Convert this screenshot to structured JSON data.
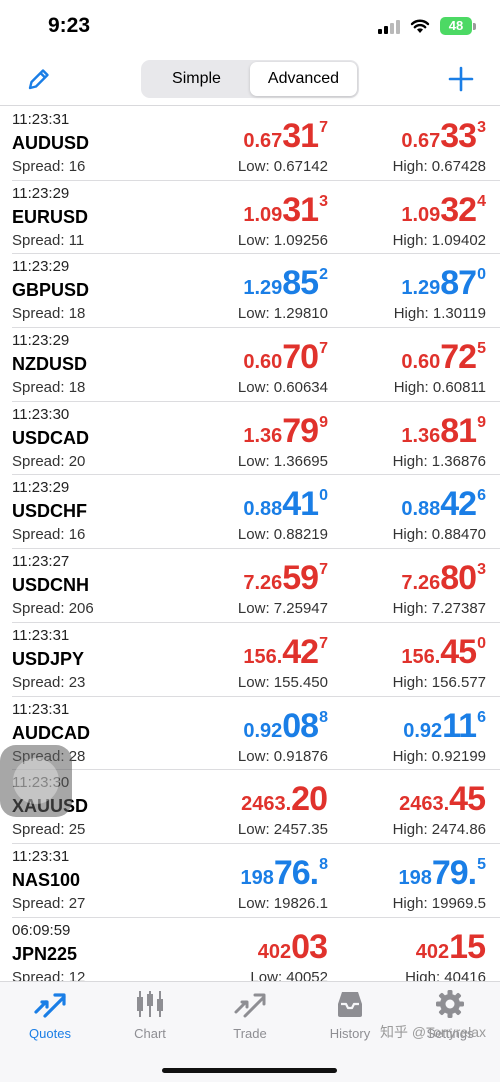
{
  "status": {
    "time": "9:23",
    "battery": "48"
  },
  "toolbar": {
    "segments": [
      {
        "label": "Simple",
        "active": false
      },
      {
        "label": "Advanced",
        "active": true
      }
    ]
  },
  "quotes": [
    {
      "time": "11:23:31",
      "symbol": "AUDUSD",
      "spread": "Spread: 16",
      "low": "Low: 0.67142",
      "high": "High: 0.67428",
      "bid": {
        "pre": "0.67",
        "big": "31",
        "sup": "7",
        "dir": "down"
      },
      "ask": {
        "pre": "0.67",
        "big": "33",
        "sup": "3",
        "dir": "down"
      }
    },
    {
      "time": "11:23:29",
      "symbol": "EURUSD",
      "spread": "Spread: 11",
      "low": "Low: 1.09256",
      "high": "High: 1.09402",
      "bid": {
        "pre": "1.09",
        "big": "31",
        "sup": "3",
        "dir": "down"
      },
      "ask": {
        "pre": "1.09",
        "big": "32",
        "sup": "4",
        "dir": "down"
      }
    },
    {
      "time": "11:23:29",
      "symbol": "GBPUSD",
      "spread": "Spread: 18",
      "low": "Low: 1.29810",
      "high": "High: 1.30119",
      "bid": {
        "pre": "1.29",
        "big": "85",
        "sup": "2",
        "dir": "up"
      },
      "ask": {
        "pre": "1.29",
        "big": "87",
        "sup": "0",
        "dir": "up"
      }
    },
    {
      "time": "11:23:29",
      "symbol": "NZDUSD",
      "spread": "Spread: 18",
      "low": "Low: 0.60634",
      "high": "High: 0.60811",
      "bid": {
        "pre": "0.60",
        "big": "70",
        "sup": "7",
        "dir": "down"
      },
      "ask": {
        "pre": "0.60",
        "big": "72",
        "sup": "5",
        "dir": "down"
      }
    },
    {
      "time": "11:23:30",
      "symbol": "USDCAD",
      "spread": "Spread: 20",
      "low": "Low: 1.36695",
      "high": "High: 1.36876",
      "bid": {
        "pre": "1.36",
        "big": "79",
        "sup": "9",
        "dir": "down"
      },
      "ask": {
        "pre": "1.36",
        "big": "81",
        "sup": "9",
        "dir": "down"
      }
    },
    {
      "time": "11:23:29",
      "symbol": "USDCHF",
      "spread": "Spread: 16",
      "low": "Low: 0.88219",
      "high": "High: 0.88470",
      "bid": {
        "pre": "0.88",
        "big": "41",
        "sup": "0",
        "dir": "up"
      },
      "ask": {
        "pre": "0.88",
        "big": "42",
        "sup": "6",
        "dir": "up"
      }
    },
    {
      "time": "11:23:27",
      "symbol": "USDCNH",
      "spread": "Spread: 206",
      "low": "Low: 7.25947",
      "high": "High: 7.27387",
      "bid": {
        "pre": "7.26",
        "big": "59",
        "sup": "7",
        "dir": "down"
      },
      "ask": {
        "pre": "7.26",
        "big": "80",
        "sup": "3",
        "dir": "down"
      }
    },
    {
      "time": "11:23:31",
      "symbol": "USDJPY",
      "spread": "Spread: 23",
      "low": "Low: 155.450",
      "high": "High: 156.577",
      "bid": {
        "pre": "156.",
        "big": "42",
        "sup": "7",
        "dir": "down"
      },
      "ask": {
        "pre": "156.",
        "big": "45",
        "sup": "0",
        "dir": "down"
      }
    },
    {
      "time": "11:23:31",
      "symbol": "AUDCAD",
      "spread": "Spread: 28",
      "low": "Low: 0.91876",
      "high": "High: 0.92199",
      "bid": {
        "pre": "0.92",
        "big": "08",
        "sup": "8",
        "dir": "up"
      },
      "ask": {
        "pre": "0.92",
        "big": "11",
        "sup": "6",
        "dir": "up"
      }
    },
    {
      "time": "11:23:30",
      "symbol": "XAUUSD",
      "spread": "Spread: 25",
      "low": "Low: 2457.35",
      "high": "High: 2474.86",
      "bid": {
        "pre": "2463.",
        "big": "20",
        "sup": "",
        "dir": "down"
      },
      "ask": {
        "pre": "2463.",
        "big": "45",
        "sup": "",
        "dir": "down"
      }
    },
    {
      "time": "11:23:31",
      "symbol": "NAS100",
      "spread": "Spread: 27",
      "low": "Low: 19826.1",
      "high": "High: 19969.5",
      "bid": {
        "pre": "198",
        "big": "76.",
        "sup": "8",
        "dir": "up"
      },
      "ask": {
        "pre": "198",
        "big": "79.",
        "sup": "5",
        "dir": "up"
      }
    },
    {
      "time": "06:09:59",
      "symbol": "JPN225",
      "spread": "Spread: 12",
      "low": "Low: 40052",
      "high": "High: 40416",
      "bid": {
        "pre": "402",
        "big": "03",
        "sup": "",
        "dir": "down"
      },
      "ask": {
        "pre": "402",
        "big": "15",
        "sup": "",
        "dir": "down"
      }
    }
  ],
  "tabs": [
    {
      "label": "Quotes",
      "icon": "quotes-icon",
      "active": true
    },
    {
      "label": "Chart",
      "icon": "chart-icon",
      "active": false
    },
    {
      "label": "Trade",
      "icon": "trade-icon",
      "active": false
    },
    {
      "label": "History",
      "icon": "history-icon",
      "active": false
    },
    {
      "label": "Settings",
      "icon": "settings-icon",
      "active": false
    }
  ],
  "watermark": "知乎 @Tonyrelax",
  "colors": {
    "up": "#1a7ee6",
    "down": "#e0322c",
    "accent": "#1a7ee6",
    "inactive_tab": "#8e8e93"
  }
}
